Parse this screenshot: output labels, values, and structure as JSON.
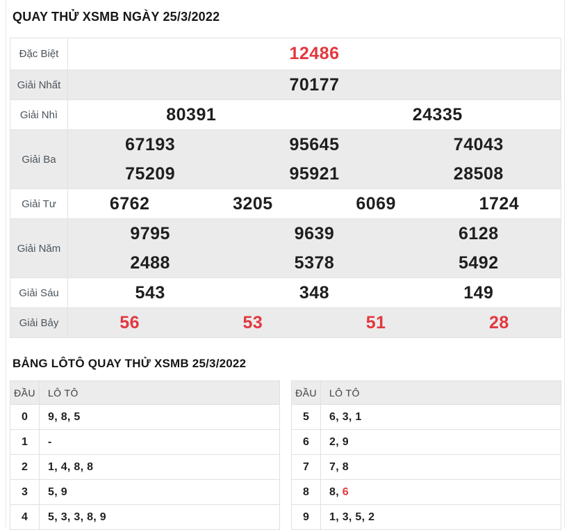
{
  "titles": {
    "main": "QUAY THỬ XSMB NGÀY 25/3/2022",
    "loto": "BẢNG LÔTÔ QUAY THỬ XSMB 25/3/2022"
  },
  "results": {
    "rows": [
      {
        "label": "Đặc Biệt",
        "lines": [
          [
            "12486"
          ]
        ]
      },
      {
        "label": "Giải Nhất",
        "lines": [
          [
            "70177"
          ]
        ]
      },
      {
        "label": "Giải Nhì",
        "lines": [
          [
            "80391",
            "24335"
          ]
        ]
      },
      {
        "label": "Giải Ba",
        "lines": [
          [
            "67193",
            "95645",
            "74043"
          ],
          [
            "75209",
            "95921",
            "28508"
          ]
        ]
      },
      {
        "label": "Giải Tư",
        "lines": [
          [
            "6762",
            "3205",
            "6069",
            "1724"
          ]
        ]
      },
      {
        "label": "Giải Năm",
        "lines": [
          [
            "9795",
            "9639",
            "6128"
          ],
          [
            "2488",
            "5378",
            "5492"
          ]
        ]
      },
      {
        "label": "Giải Sáu",
        "lines": [
          [
            "543",
            "348",
            "149"
          ]
        ]
      },
      {
        "label": "Giải Bảy",
        "lines": [
          [
            "56",
            "53",
            "51",
            "28"
          ]
        ]
      }
    ]
  },
  "loto": {
    "headers": {
      "dau": "ĐẦU",
      "values": "LÔ TÔ"
    },
    "left": [
      {
        "dau": "0",
        "values": "9, 8, 5"
      },
      {
        "dau": "1",
        "values": "-"
      },
      {
        "dau": "2",
        "values": "1, 4, 8, 8"
      },
      {
        "dau": "3",
        "values": "5, 9"
      },
      {
        "dau": "4",
        "values": "5, 3, 3, 8, 9"
      }
    ],
    "right": [
      {
        "dau": "5",
        "values": "6, 3, 1"
      },
      {
        "dau": "6",
        "values": "2, 9"
      },
      {
        "dau": "7",
        "values": "7, 8"
      },
      {
        "dau": "8",
        "values": "8, ",
        "values_red": "6"
      },
      {
        "dau": "9",
        "values": "1, 3, 5, 2"
      }
    ]
  },
  "colors": {
    "red": "#e2383e",
    "row_shade": "#ebebeb",
    "border": "#e2e2e2",
    "label_text": "#4a545c",
    "number_text": "#1e1e1e"
  }
}
